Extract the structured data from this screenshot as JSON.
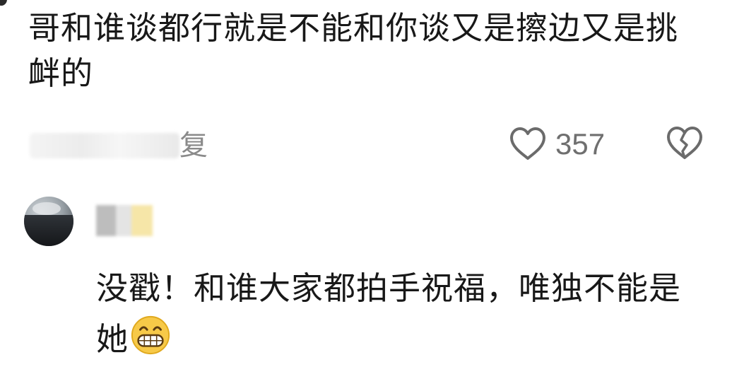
{
  "comment": {
    "text": "哥和谁谈都行就是不能和你谈又是擦边又是挑衅的",
    "reply_label": "复",
    "like_count": "357"
  },
  "reply": {
    "text": "没戳！和谁大家都拍手祝福，唯独不能是她",
    "emoji": "grinning-face-icon"
  },
  "colors": {
    "text": "#181818",
    "secondary": "#6f6f6f",
    "icon_stroke": "#6b6b6b"
  }
}
